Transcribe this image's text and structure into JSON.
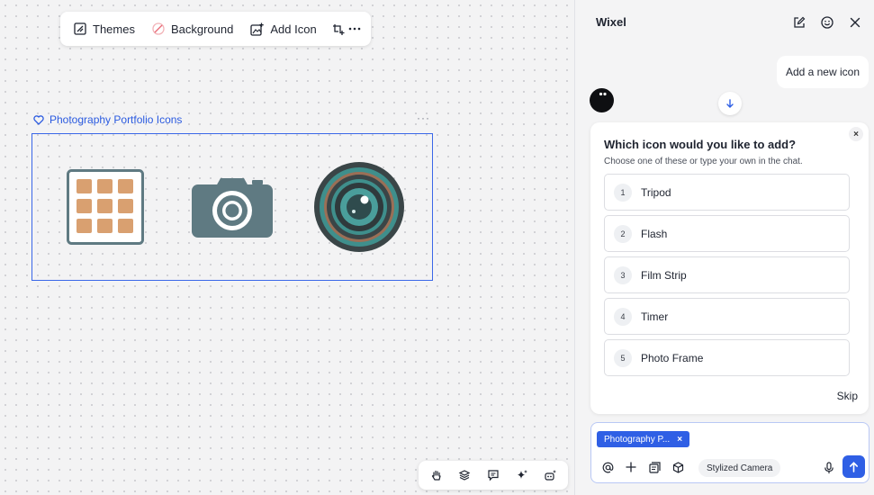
{
  "toolbar": {
    "themes_label": "Themes",
    "background_label": "Background",
    "add_icon_label": "Add Icon"
  },
  "canvas": {
    "selection_title": "Photography Portfolio Icons",
    "more_label": "···",
    "icons": [
      "grid-gallery-icon",
      "camera-icon",
      "lens-icon"
    ]
  },
  "panel": {
    "title": "Wixel",
    "user_message": "Add a new icon",
    "card": {
      "title": "Which icon would you like to add?",
      "subtitle": "Choose one of these or type your own in the chat.",
      "options": [
        {
          "num": "1",
          "label": "Tripod"
        },
        {
          "num": "2",
          "label": "Flash"
        },
        {
          "num": "3",
          "label": "Film Strip"
        },
        {
          "num": "4",
          "label": "Timer"
        },
        {
          "num": "5",
          "label": "Photo Frame"
        }
      ],
      "skip_label": "Skip"
    },
    "composer": {
      "chip_label": "Photography P...",
      "suggestion": "Stylized Camera"
    }
  },
  "colors": {
    "accent": "#2f5fe5",
    "tile": "#d9a070",
    "frame": "#5f7a82",
    "teal": "#3f8f8c"
  }
}
